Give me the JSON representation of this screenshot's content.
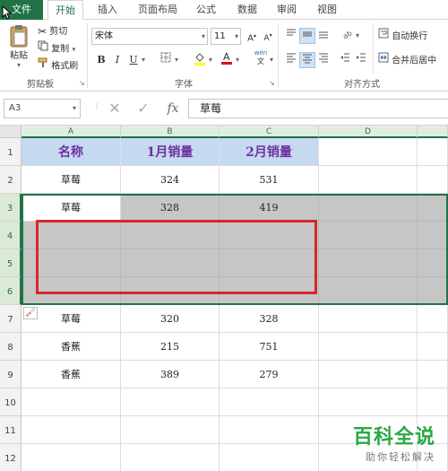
{
  "tabs": [
    "文件",
    "开始",
    "插入",
    "页面布局",
    "公式",
    "数据",
    "审阅",
    "视图"
  ],
  "active_tab": "开始",
  "clipboard": {
    "paste_label": "粘贴",
    "cut_label": "剪切",
    "copy_label": "复制",
    "format_painter_label": "格式刷",
    "group_label": "剪贴板"
  },
  "font": {
    "name": "宋体",
    "size": "11",
    "bold": "B",
    "italic": "I",
    "underline": "U",
    "wen": "wén",
    "group_label": "字体"
  },
  "alignment": {
    "wrap_text_label": "自动换行",
    "merge_center_label": "合并后居中",
    "group_label": "对齐方式"
  },
  "formula_bar": {
    "name_box": "A3",
    "fx_label": "fx",
    "value": "草莓"
  },
  "columns": [
    "A",
    "B",
    "C",
    "D"
  ],
  "rows": [
    "1",
    "2",
    "3",
    "4",
    "5",
    "6",
    "7",
    "8",
    "9",
    "10",
    "11",
    "12"
  ],
  "headers": [
    "名称",
    "1月销量",
    "2月销量"
  ],
  "cells": [
    [
      "草莓",
      "324",
      "531"
    ],
    [
      "草莓",
      "328",
      "419"
    ],
    [
      "",
      "",
      ""
    ],
    [
      "",
      "",
      ""
    ],
    [
      "",
      "",
      ""
    ],
    [
      "草莓",
      "320",
      "328"
    ],
    [
      "香蕉",
      "215",
      "751"
    ],
    [
      "香蕉",
      "389",
      "279"
    ],
    [
      "",
      "",
      ""
    ],
    [
      "",
      "",
      ""
    ],
    [
      "",
      "",
      ""
    ]
  ],
  "watermark": {
    "title": "百科全说",
    "subtitle": "助你轻松解决"
  },
  "colors": {
    "excel_green": "#217346",
    "header_fill": "#c5d9f1",
    "header_text": "#7030a0",
    "selection_grey": "#c6c6c6",
    "annotation_red": "#d9262a",
    "watermark_green": "#2aa842"
  }
}
